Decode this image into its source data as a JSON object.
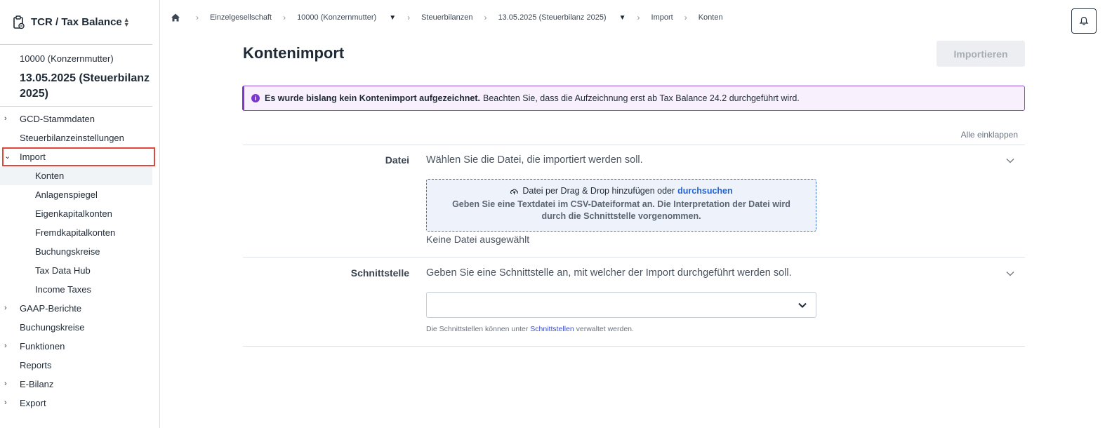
{
  "app": {
    "title": "TCR / Tax Balance"
  },
  "context": {
    "company": "10000 (Konzernmutter)",
    "balance": "13.05.2025 (Steuerbilanz 2025)"
  },
  "nav": {
    "gcd": "GCD-Stammdaten",
    "steuer": "Steuerbilanzeinstellungen",
    "import": "Import",
    "import_sub": [
      "Konten",
      "Anlagenspiegel",
      "Eigenkapitalkonten",
      "Fremdkapitalkonten",
      "Buchungskreise",
      "Tax Data Hub",
      "Income Taxes"
    ],
    "gaap": "GAAP-Berichte",
    "buchungskreise": "Buchungskreise",
    "funktionen": "Funktionen",
    "reports": "Reports",
    "ebilanz": "E-Bilanz",
    "export": "Export"
  },
  "breadcrumb": {
    "einzel": "Einzelgesellschaft",
    "company": "10000 (Konzernmutter)",
    "steuer": "Steuerbilanzen",
    "balance": "13.05.2025 (Steuerbilanz 2025)",
    "import": "Import",
    "konten": "Konten"
  },
  "page": {
    "title": "Kontenimport",
    "import_button": "Importieren",
    "alert_bold": "Es wurde bislang kein Kontenimport aufgezeichnet.",
    "alert_text": "Beachten Sie, dass die Aufzeichnung erst ab Tax Balance 24.2 durchgeführt wird.",
    "collapse_all": "Alle einklappen"
  },
  "file_section": {
    "label": "Datei",
    "desc": "Wählen Sie die Datei, die importiert werden soll.",
    "drop_text": "Datei per Drag & Drop hinzufügen oder",
    "browse": "durchsuchen",
    "drop_hint": "Geben Sie eine Textdatei im CSV-Dateiformat an. Die Interpretation der Datei wird durch die Schnittstelle vorgenommen.",
    "no_file": "Keine Datei ausgewählt"
  },
  "interface_section": {
    "label": "Schnittstelle",
    "desc": "Geben Sie eine Schnittstelle an, mit welcher der Import durchgeführt werden soll.",
    "selected": "",
    "hint_pre": "Die Schnittstellen können unter",
    "hint_link": "Schnittstellen",
    "hint_post": "verwaltet werden."
  },
  "colors": {
    "accent": "#7c36cf",
    "link": "#2364d2",
    "highlight": "#e0463a"
  }
}
